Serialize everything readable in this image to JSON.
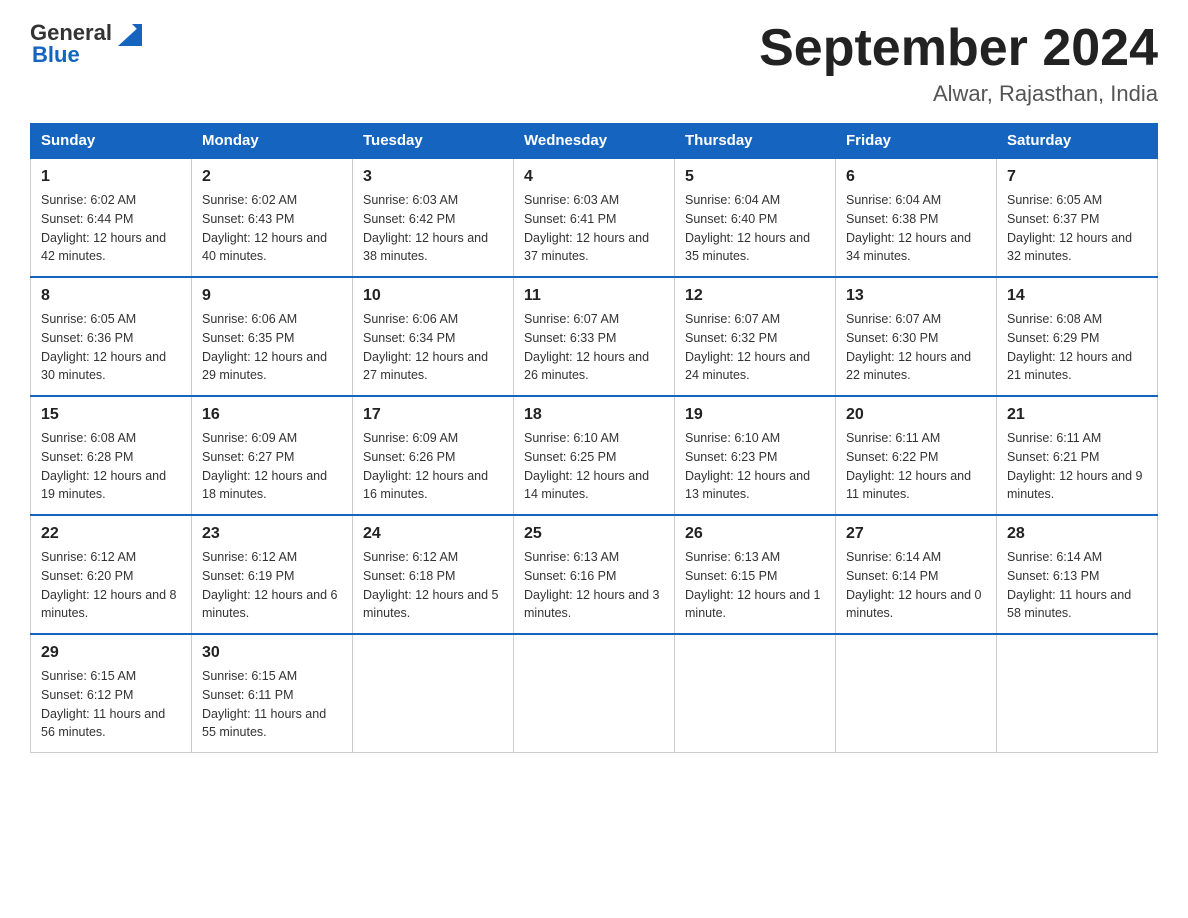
{
  "logo": {
    "general": "General",
    "blue": "Blue"
  },
  "header": {
    "month_year": "September 2024",
    "location": "Alwar, Rajasthan, India"
  },
  "days_of_week": [
    "Sunday",
    "Monday",
    "Tuesday",
    "Wednesday",
    "Thursday",
    "Friday",
    "Saturday"
  ],
  "weeks": [
    [
      {
        "day": "1",
        "sunrise": "6:02 AM",
        "sunset": "6:44 PM",
        "daylight": "12 hours and 42 minutes."
      },
      {
        "day": "2",
        "sunrise": "6:02 AM",
        "sunset": "6:43 PM",
        "daylight": "12 hours and 40 minutes."
      },
      {
        "day": "3",
        "sunrise": "6:03 AM",
        "sunset": "6:42 PM",
        "daylight": "12 hours and 38 minutes."
      },
      {
        "day": "4",
        "sunrise": "6:03 AM",
        "sunset": "6:41 PM",
        "daylight": "12 hours and 37 minutes."
      },
      {
        "day": "5",
        "sunrise": "6:04 AM",
        "sunset": "6:40 PM",
        "daylight": "12 hours and 35 minutes."
      },
      {
        "day": "6",
        "sunrise": "6:04 AM",
        "sunset": "6:38 PM",
        "daylight": "12 hours and 34 minutes."
      },
      {
        "day": "7",
        "sunrise": "6:05 AM",
        "sunset": "6:37 PM",
        "daylight": "12 hours and 32 minutes."
      }
    ],
    [
      {
        "day": "8",
        "sunrise": "6:05 AM",
        "sunset": "6:36 PM",
        "daylight": "12 hours and 30 minutes."
      },
      {
        "day": "9",
        "sunrise": "6:06 AM",
        "sunset": "6:35 PM",
        "daylight": "12 hours and 29 minutes."
      },
      {
        "day": "10",
        "sunrise": "6:06 AM",
        "sunset": "6:34 PM",
        "daylight": "12 hours and 27 minutes."
      },
      {
        "day": "11",
        "sunrise": "6:07 AM",
        "sunset": "6:33 PM",
        "daylight": "12 hours and 26 minutes."
      },
      {
        "day": "12",
        "sunrise": "6:07 AM",
        "sunset": "6:32 PM",
        "daylight": "12 hours and 24 minutes."
      },
      {
        "day": "13",
        "sunrise": "6:07 AM",
        "sunset": "6:30 PM",
        "daylight": "12 hours and 22 minutes."
      },
      {
        "day": "14",
        "sunrise": "6:08 AM",
        "sunset": "6:29 PM",
        "daylight": "12 hours and 21 minutes."
      }
    ],
    [
      {
        "day": "15",
        "sunrise": "6:08 AM",
        "sunset": "6:28 PM",
        "daylight": "12 hours and 19 minutes."
      },
      {
        "day": "16",
        "sunrise": "6:09 AM",
        "sunset": "6:27 PM",
        "daylight": "12 hours and 18 minutes."
      },
      {
        "day": "17",
        "sunrise": "6:09 AM",
        "sunset": "6:26 PM",
        "daylight": "12 hours and 16 minutes."
      },
      {
        "day": "18",
        "sunrise": "6:10 AM",
        "sunset": "6:25 PM",
        "daylight": "12 hours and 14 minutes."
      },
      {
        "day": "19",
        "sunrise": "6:10 AM",
        "sunset": "6:23 PM",
        "daylight": "12 hours and 13 minutes."
      },
      {
        "day": "20",
        "sunrise": "6:11 AM",
        "sunset": "6:22 PM",
        "daylight": "12 hours and 11 minutes."
      },
      {
        "day": "21",
        "sunrise": "6:11 AM",
        "sunset": "6:21 PM",
        "daylight": "12 hours and 9 minutes."
      }
    ],
    [
      {
        "day": "22",
        "sunrise": "6:12 AM",
        "sunset": "6:20 PM",
        "daylight": "12 hours and 8 minutes."
      },
      {
        "day": "23",
        "sunrise": "6:12 AM",
        "sunset": "6:19 PM",
        "daylight": "12 hours and 6 minutes."
      },
      {
        "day": "24",
        "sunrise": "6:12 AM",
        "sunset": "6:18 PM",
        "daylight": "12 hours and 5 minutes."
      },
      {
        "day": "25",
        "sunrise": "6:13 AM",
        "sunset": "6:16 PM",
        "daylight": "12 hours and 3 minutes."
      },
      {
        "day": "26",
        "sunrise": "6:13 AM",
        "sunset": "6:15 PM",
        "daylight": "12 hours and 1 minute."
      },
      {
        "day": "27",
        "sunrise": "6:14 AM",
        "sunset": "6:14 PM",
        "daylight": "12 hours and 0 minutes."
      },
      {
        "day": "28",
        "sunrise": "6:14 AM",
        "sunset": "6:13 PM",
        "daylight": "11 hours and 58 minutes."
      }
    ],
    [
      {
        "day": "29",
        "sunrise": "6:15 AM",
        "sunset": "6:12 PM",
        "daylight": "11 hours and 56 minutes."
      },
      {
        "day": "30",
        "sunrise": "6:15 AM",
        "sunset": "6:11 PM",
        "daylight": "11 hours and 55 minutes."
      },
      null,
      null,
      null,
      null,
      null
    ]
  ],
  "labels": {
    "sunrise": "Sunrise:",
    "sunset": "Sunset:",
    "daylight": "Daylight:"
  }
}
